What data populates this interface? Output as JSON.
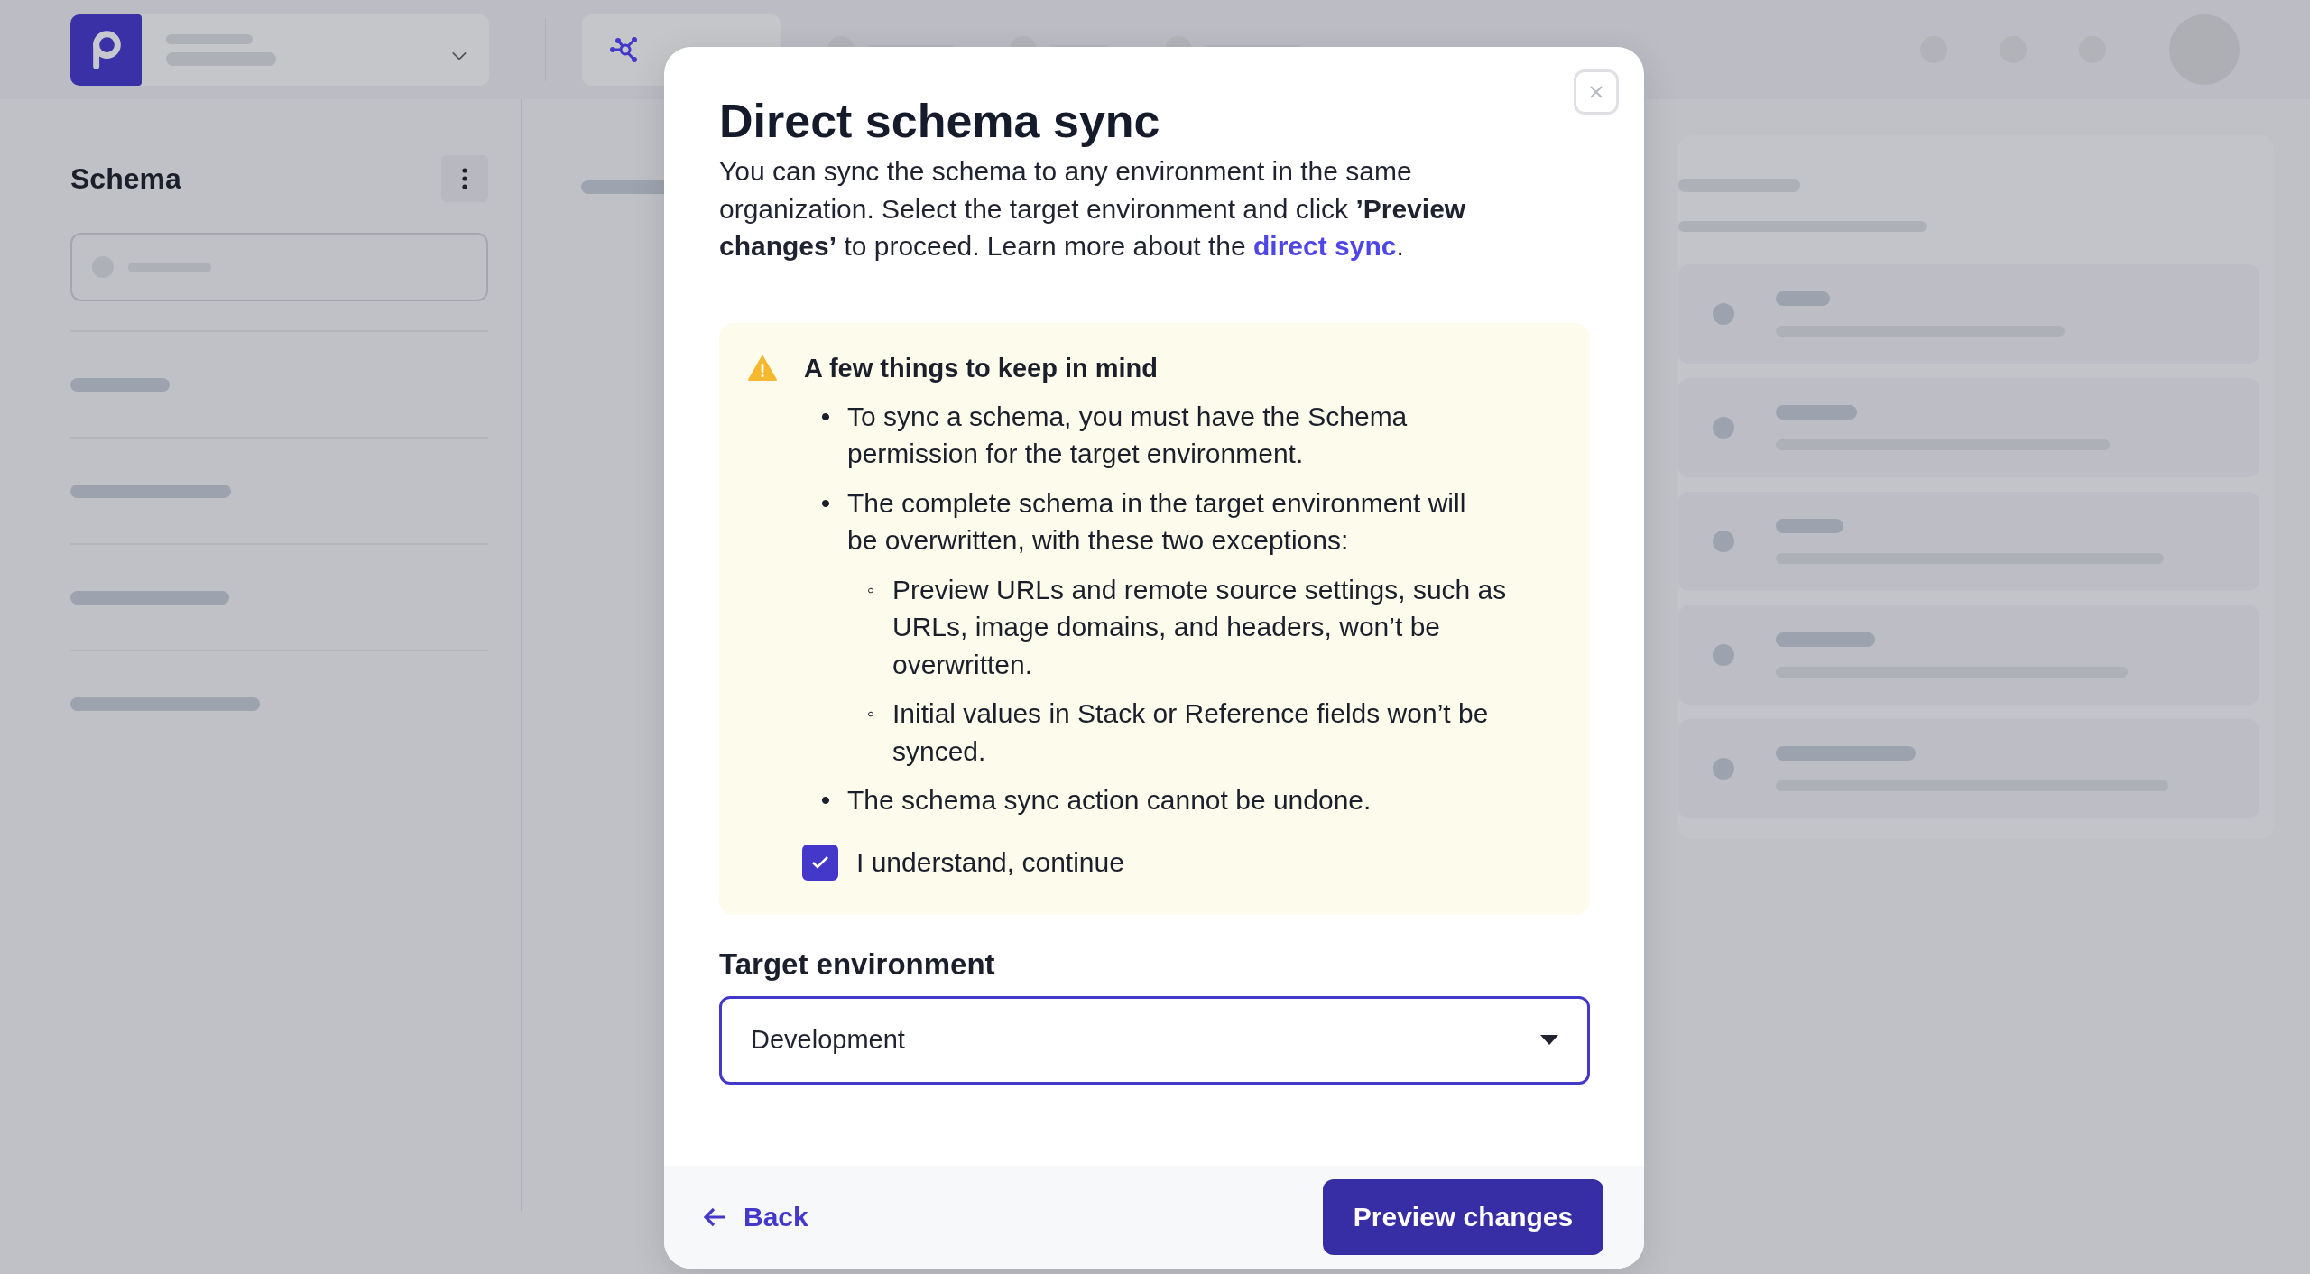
{
  "topbar": {
    "tab": {
      "selected": true
    }
  },
  "sidebar": {
    "title": "Schema"
  },
  "dialog": {
    "title": "Direct schema sync",
    "intro": "You can sync the schema to any environment in the same organization. Select the target environment and click **’Preview changes’** to proceed. Learn more about the ",
    "intro_link": "direct sync",
    "intro_end": ".",
    "warning": {
      "title": "A few things to keep in mind",
      "items": [
        {
          "marker": "•",
          "text": "To sync a schema, you must have the Schema permission for the target environment."
        },
        {
          "marker": "•",
          "text": "The complete schema in the target environment will be overwritten, with these two exceptions:",
          "children": [
            {
              "marker": "◦",
              "text": "Preview URLs and remote source settings, such as URLs, image domains, and headers, won’t be overwritten."
            },
            {
              "marker": "◦",
              "text": "Initial values in Stack or Reference fields won’t be synced."
            }
          ]
        },
        {
          "marker": "•",
          "text": "The schema sync action cannot be undone."
        }
      ]
    },
    "confirm": {
      "label": "I understand, continue",
      "checked": true
    },
    "target": {
      "label": "Target environment",
      "value": "Development"
    },
    "back": "Back",
    "primary": "Preview changes"
  }
}
